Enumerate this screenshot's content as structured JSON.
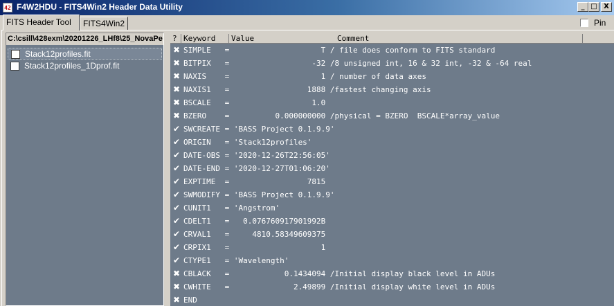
{
  "window": {
    "icon_text": "42",
    "title": "F4W2HDU - FITS4Win2 Header Data Utility",
    "buttons": {
      "minimize": "_",
      "maximize": "□",
      "close": "X"
    }
  },
  "tabs": [
    {
      "label": "FITS Header Tool",
      "active": true
    },
    {
      "label": "FITS4Win2",
      "active": false
    }
  ],
  "pin": {
    "label": "Pin",
    "checked": false
  },
  "left": {
    "path": "C:\\csill\\428exm\\20201226_LHf8\\25_NovaPe",
    "files": [
      {
        "name": "Stack12profiles.fit",
        "checked": false,
        "selected": true
      },
      {
        "name": "Stack12profiles_1Dprof.fit",
        "checked": false,
        "selected": false
      }
    ]
  },
  "header_columns": {
    "q": "?",
    "keyword": "Keyword",
    "value": "Value",
    "comment": "Comment"
  },
  "rows": [
    {
      "icon": "x",
      "text": "SIMPLE   =                    T / file does conform to FITS standard"
    },
    {
      "icon": "x",
      "text": "BITPIX   =                  -32 /8 unsigned int, 16 & 32 int, -32 & -64 real"
    },
    {
      "icon": "x",
      "text": "NAXIS    =                    1 / number of data axes"
    },
    {
      "icon": "x",
      "text": "NAXIS1   =                 1888 /fastest changing axis"
    },
    {
      "icon": "x",
      "text": "BSCALE   =                  1.0"
    },
    {
      "icon": "x",
      "text": "BZERO    =          0.000000000 /physical = BZERO  BSCALE*array_value"
    },
    {
      "icon": "check",
      "text": "SWCREATE = 'BASS Project 0.1.9.9'"
    },
    {
      "icon": "check",
      "text": "ORIGIN   = 'Stack12profiles'"
    },
    {
      "icon": "check",
      "text": "DATE-OBS = '2020-12-26T22:56:05'"
    },
    {
      "icon": "check",
      "text": "DATE-END = '2020-12-27T01:06:20'"
    },
    {
      "icon": "check",
      "text": "EXPTIME  =                 7815"
    },
    {
      "icon": "check",
      "text": "SWMODIFY = 'BASS Project 0.1.9.9'"
    },
    {
      "icon": "check",
      "text": "CUNIT1   = 'Angstrom'"
    },
    {
      "icon": "check",
      "text": "CDELT1   =   0.076760917901992B"
    },
    {
      "icon": "check",
      "text": "CRVAL1   =     4810.58349609375"
    },
    {
      "icon": "check",
      "text": "CRPIX1   =                    1"
    },
    {
      "icon": "check",
      "text": "CTYPE1   = 'Wavelength'"
    },
    {
      "icon": "x",
      "text": "CBLACK   =            0.1434094 /Initial display black level in ADUs"
    },
    {
      "icon": "x",
      "text": "CWHITE   =              2.49899 /Initial display white level in ADUs"
    },
    {
      "icon": "x",
      "text": "END"
    }
  ],
  "icon_names": {
    "x": "x-mark-icon",
    "check": "check-mark-icon"
  },
  "colors": {
    "list_bg": "#6e7b8a",
    "title_start": "#0a246a"
  }
}
